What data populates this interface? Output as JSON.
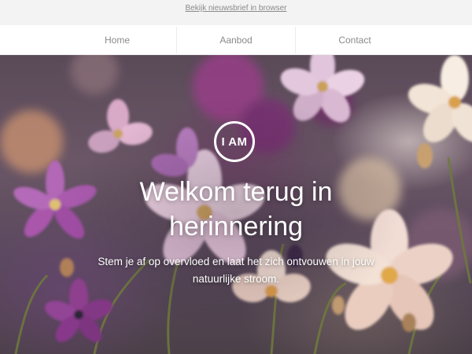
{
  "topbar": {
    "view_in_browser": "Bekijk nieuwsbrief in browser"
  },
  "nav": {
    "items": [
      {
        "label": "Home"
      },
      {
        "label": "Aanbod"
      },
      {
        "label": "Contact"
      }
    ]
  },
  "hero": {
    "logo_text": "I AM",
    "title": "Welkom terug in herinnering",
    "subtitle": "Stem je af op overvloed en laat het zich ontvouwen in jouw natuurlijke stroom."
  },
  "colors": {
    "accent_text": "#ffffff",
    "muted_text": "#8a8a8a",
    "nav_bg": "#ffffff",
    "page_bg": "#f3f3f3"
  }
}
